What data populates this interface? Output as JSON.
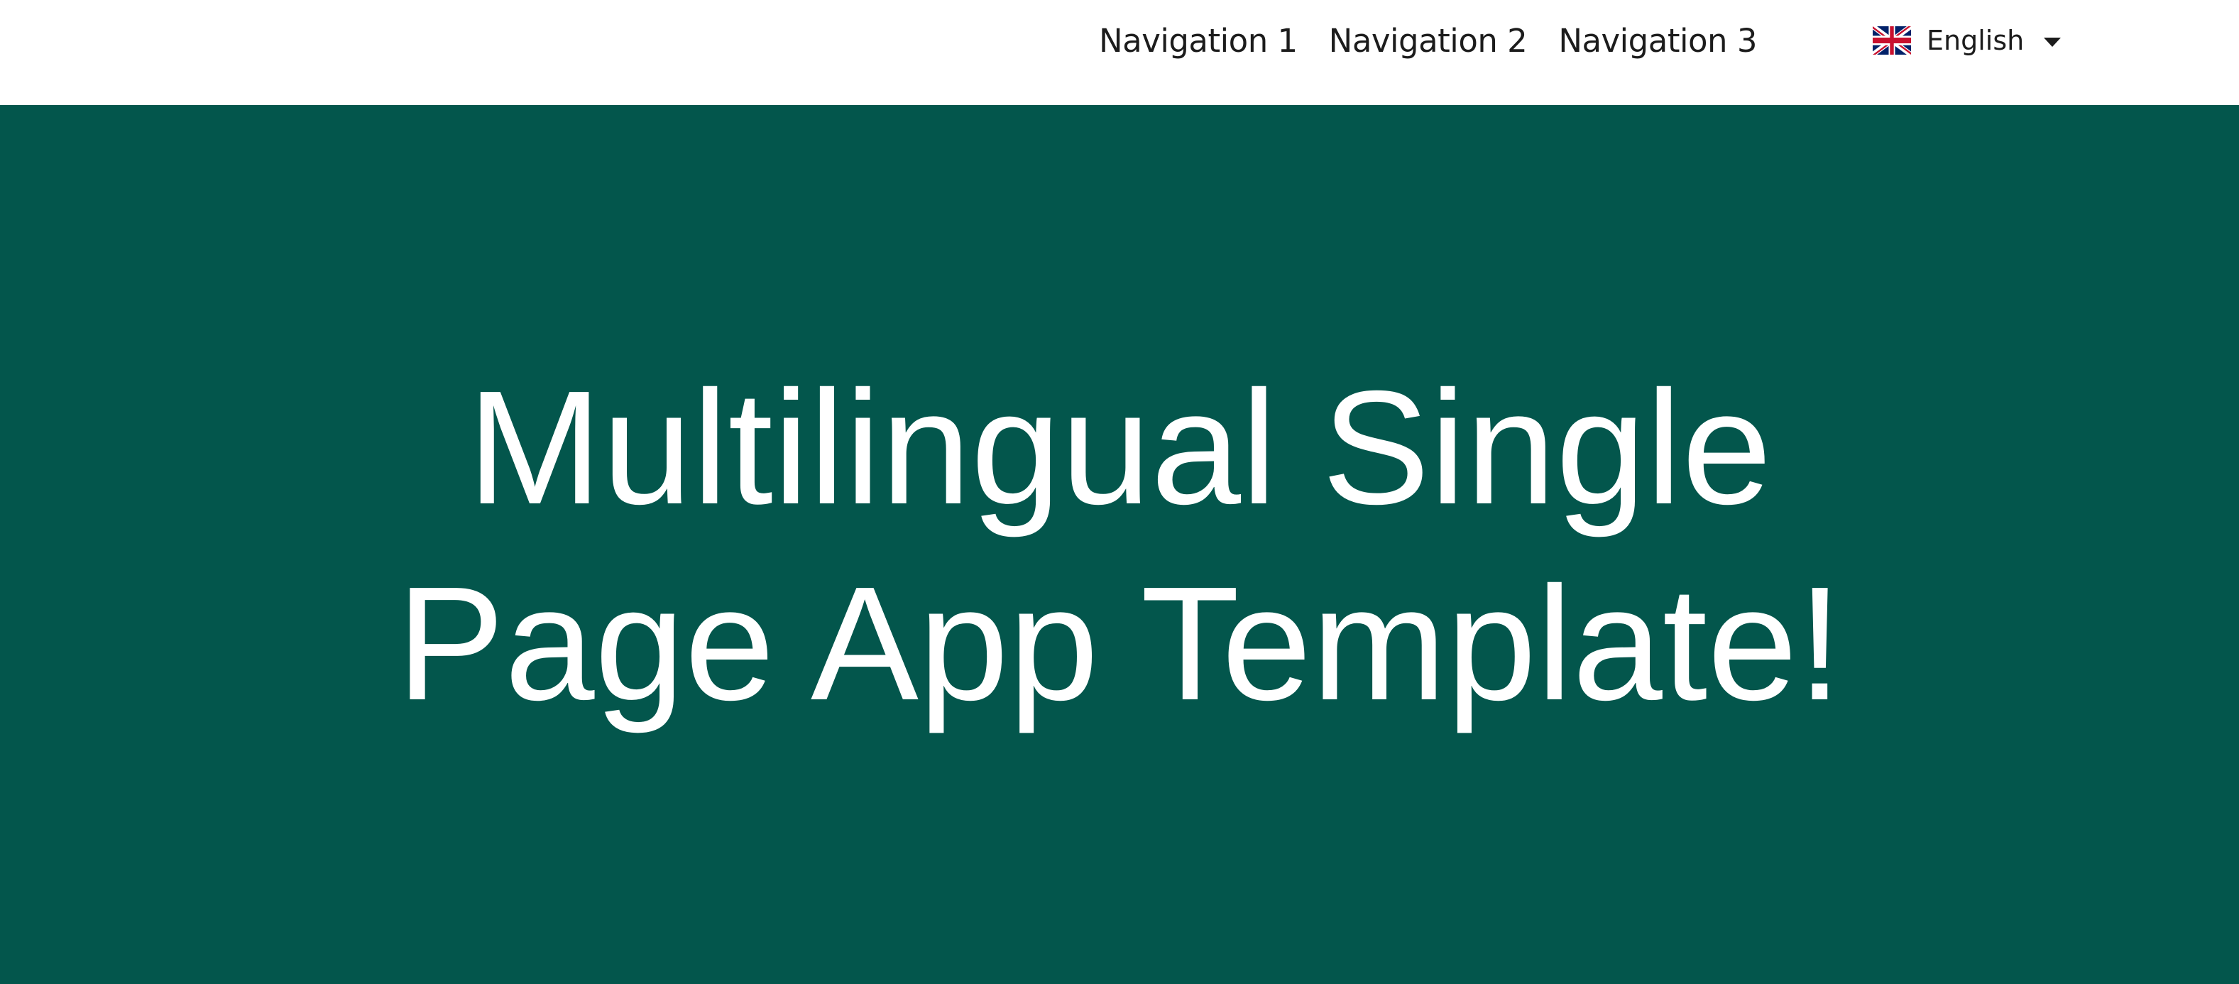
{
  "nav": {
    "items": [
      {
        "label": "Navigation 1"
      },
      {
        "label": "Navigation 2"
      },
      {
        "label": "Navigation 3"
      }
    ]
  },
  "language": {
    "selected": "English",
    "flag_icon": "uk-flag-icon",
    "caret_icon": "caret-down-icon"
  },
  "hero": {
    "title_line1": "Multilingual Single",
    "title_line2": "Page App Template!"
  },
  "colors": {
    "hero_background": "#03564c",
    "hero_text": "#ffffff",
    "nav_text": "#1c1c1c",
    "header_background": "#ffffff"
  }
}
